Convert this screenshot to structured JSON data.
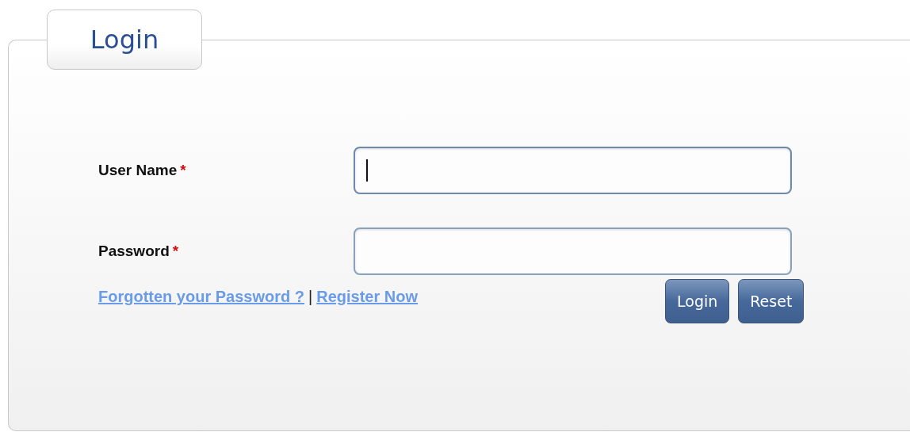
{
  "panel": {
    "title": "Login"
  },
  "fields": [
    {
      "label": "User Name",
      "required_mark": "*",
      "focused": true
    },
    {
      "label": "Password",
      "required_mark": "*",
      "focused": false
    }
  ],
  "links": [
    {
      "text": "Forgotten your Password ?"
    },
    {
      "text": "Register Now"
    }
  ],
  "link_separator": "|",
  "buttons": [
    "Login",
    "Reset"
  ]
}
